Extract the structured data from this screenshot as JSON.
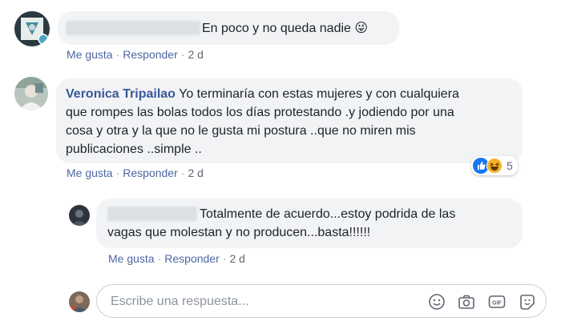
{
  "comments": [
    {
      "author": "",
      "text": "En poco y no queda nadie 😜",
      "actions": {
        "like": "Me gusta",
        "reply": "Responder",
        "time": "2 d"
      }
    },
    {
      "author": "Veronica Tripailao",
      "text_lines": [
        "Yo terminaría con estas mujeres y con cualquiera",
        "que rompes las bolas todos los días protestando .y jodiendo por una",
        "cosa y otra y la que no le gusta mi postura ..que no miren mis",
        "publicaciones ..simple .."
      ],
      "reactions": {
        "count": "5",
        "icons": [
          "like-icon",
          "haha-icon"
        ]
      },
      "actions": {
        "like": "Me gusta",
        "reply": "Responder",
        "time": "2 d"
      }
    },
    {
      "author": "",
      "text_lines": [
        "Totalmente de acuerdo...estoy podrida de las",
        "vagas que molestan y no producen...basta!!!!!!"
      ],
      "actions": {
        "like": "Me gusta",
        "reply": "Responder",
        "time": "2 d"
      }
    }
  ],
  "reply_box": {
    "placeholder": "Escribe una respuesta...",
    "tools": [
      "emoji-icon",
      "camera-icon",
      "gif-icon",
      "sticker-icon"
    ]
  },
  "colors": {
    "link": "#385898",
    "bubble": "#f2f3f5",
    "meta": "#606770",
    "like_blue": "#1877f2",
    "haha_yellow": "#f7b125"
  }
}
